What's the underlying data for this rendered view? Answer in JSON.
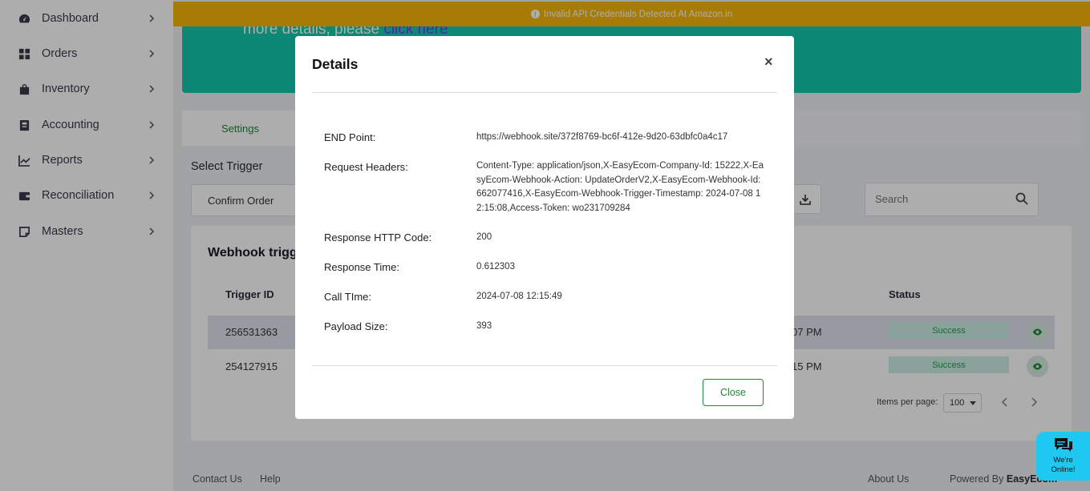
{
  "sidebar": {
    "items": [
      {
        "label": "Dashboard",
        "icon": "dashboard-gauge-icon"
      },
      {
        "label": "Orders",
        "icon": "grid-icon"
      },
      {
        "label": "Inventory",
        "icon": "bag-icon"
      },
      {
        "label": "Accounting",
        "icon": "ledger-icon"
      },
      {
        "label": "Reports",
        "icon": "chart-icon"
      },
      {
        "label": "Reconciliation",
        "icon": "wallet-icon"
      },
      {
        "label": "Masters",
        "icon": "note-icon"
      }
    ]
  },
  "banner": {
    "text": "Invalid API Credentials Detected At Amazon.in",
    "color": "#f5b70a"
  },
  "teal_card": {
    "text": "more details, please",
    "link": "click here"
  },
  "tabs": {
    "settings_label": "Settings"
  },
  "filters": {
    "select_trigger_label": "Select Trigger",
    "trigger_value": "Confirm Order",
    "search_placeholder": "Search"
  },
  "table": {
    "title": "Webhook trigge",
    "headers": {
      "trigger_id": "Trigger ID",
      "status": "Status"
    },
    "rows": [
      {
        "trigger_id": "256531363",
        "time_fragment": "07 PM",
        "status": "Success"
      },
      {
        "trigger_id": "254127915",
        "time_fragment": "15 PM",
        "status": "Success"
      }
    ],
    "items_per_page_label": "Items per page:",
    "items_per_page": "100"
  },
  "footer": {
    "contact": "Contact Us",
    "help": "Help",
    "about": "About Us",
    "powered_prefix": "Powered By",
    "powered_brand": "EasyEcom"
  },
  "chat": {
    "line1": "We're",
    "line2": "Online!"
  },
  "modal": {
    "title": "Details",
    "close_label": "Close",
    "fields": [
      {
        "label": "END Point:",
        "value": "https://webhook.site/372f8769-bc6f-412e-9d20-63dbfc0a4c17"
      },
      {
        "label": "Request Headers:",
        "value": "Content-Type: application/json,X-EasyEcom-Company-Id: 15222,X-EasyEcom-Webhook-Action: UpdateOrderV2,X-EasyEcom-Webhook-Id: 662077416,X-EasyEcom-Webhook-Trigger-Timestamp: 2024-07-08 12:15:08,Access-Token: wo231709284"
      },
      {
        "label": "Response HTTP Code:",
        "value": "200"
      },
      {
        "label": "Response Time:",
        "value": "0.612303"
      },
      {
        "label": "Call TIme:",
        "value": "2024-07-08 12:15:49"
      },
      {
        "label": "Payload Size:",
        "value": "393"
      }
    ]
  },
  "colors": {
    "accent_green": "#1d8a3a",
    "teal": "#14c9b0",
    "success_bg": "#cdeee6"
  }
}
